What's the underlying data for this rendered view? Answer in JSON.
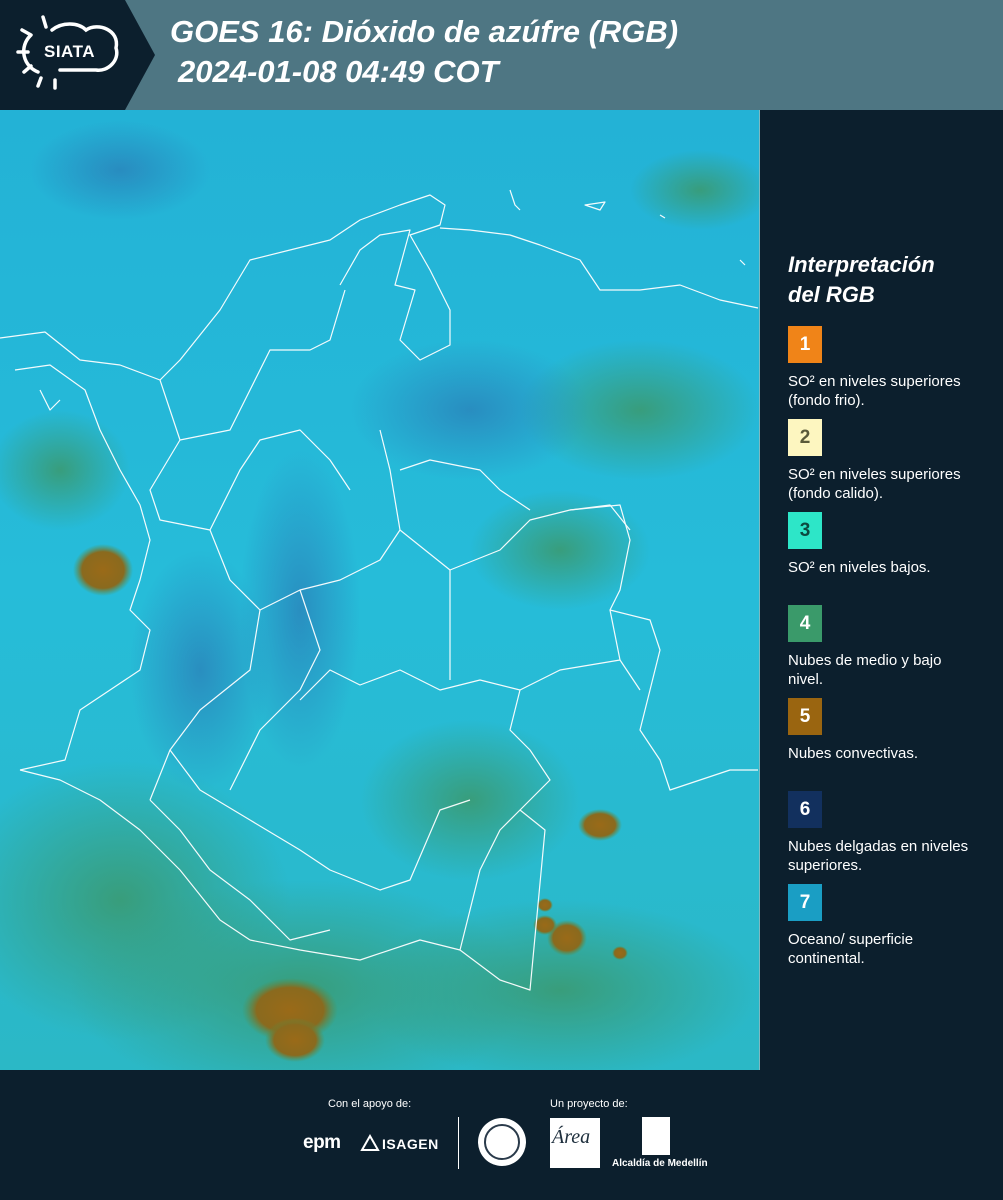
{
  "header": {
    "brand": "SIATA",
    "title": "GOES 16: Dióxido de azúfre (RGB)",
    "subtitle": "2024-01-08 04:49 COT"
  },
  "legend": {
    "title_line1": "Interpretación",
    "title_line2": "del RGB",
    "items": [
      {
        "number": "1",
        "color": "#f08418",
        "text": "SO² en niveles superiores (fondo frio)."
      },
      {
        "number": "2",
        "color": "#fdf6c0",
        "text": "SO² en niveles superiores (fondo calido)."
      },
      {
        "number": "3",
        "color": "#2de6c8",
        "text": "SO² en niveles bajos."
      },
      {
        "number": "4",
        "color": "#3a9a6a",
        "text": "Nubes de medio y bajo nivel."
      },
      {
        "number": "5",
        "color": "#9a6510",
        "text": "Nubes convectivas."
      },
      {
        "number": "6",
        "color": "#12305e",
        "text": "Nubes delgadas en niveles superiores."
      },
      {
        "number": "7",
        "color": "#1a9ec4",
        "text": "Oceano/ superficie continental."
      }
    ]
  },
  "footer": {
    "support_label": "Con el apoyo de:",
    "project_label": "Un proyecto de:",
    "sponsor_1": "epm",
    "sponsor_2": "ISAGEN",
    "partner_area": "Área",
    "partner_alcaldia": "Alcaldía de Medellín"
  }
}
